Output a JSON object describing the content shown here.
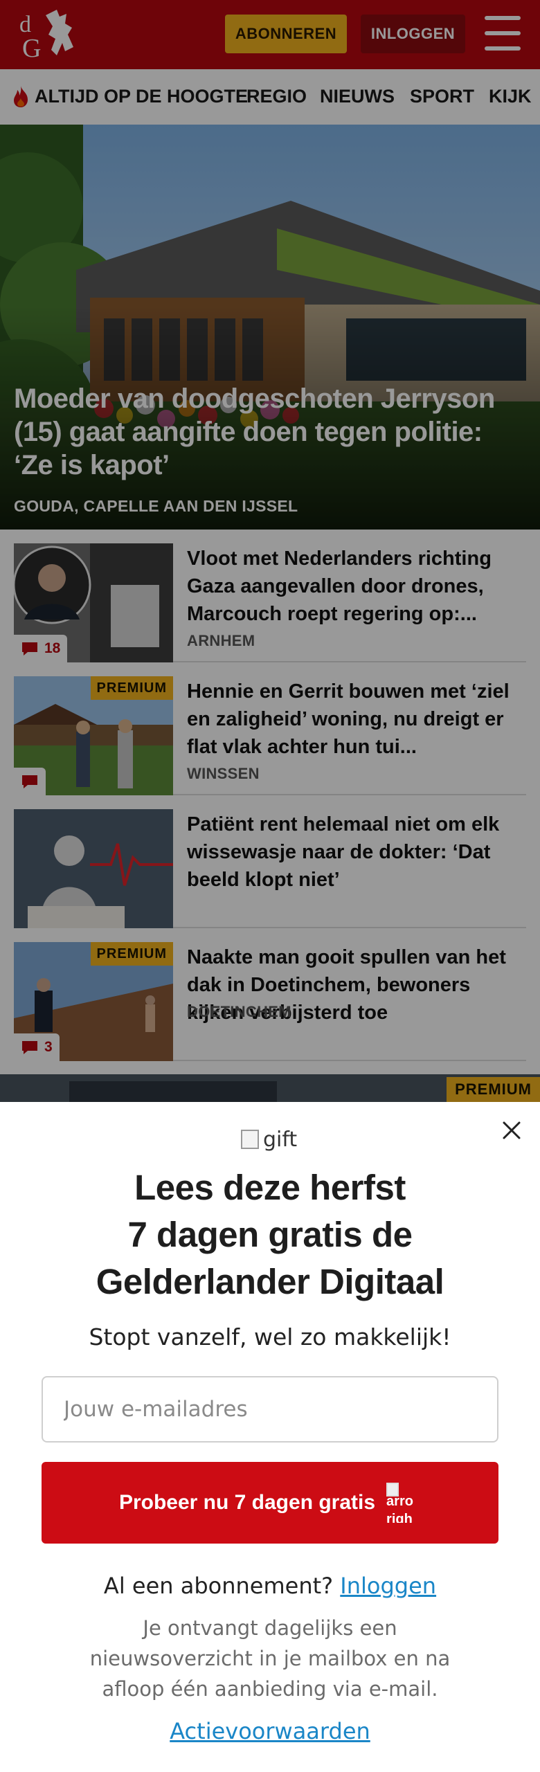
{
  "header": {
    "logo_text": "dG",
    "subscribe_label": "ABONNEREN",
    "login_label": "INLOGGEN",
    "brand_color": "#b7080f",
    "accent_color": "#f2b21f"
  },
  "nav": {
    "items": [
      {
        "label": "ALTIJD OP DE HOOGTE",
        "icon": "flame-icon"
      },
      {
        "label": "REGIO"
      },
      {
        "label": "NIEUWS"
      },
      {
        "label": "SPORT"
      },
      {
        "label": "KIJK"
      }
    ]
  },
  "hero": {
    "title": "Moeder van doodgeschoten Jerryson (15) gaat aangifte doen tegen politie: ‘Ze is kapot’",
    "location": "GOUDA, CAPELLE AAN DEN IJSSEL"
  },
  "articles": [
    {
      "title": "Vloot met Nederlanders richting Gaza aangevallen door drones, Marcouch roept regering op:...",
      "location": "ARNHEM",
      "comments": "18",
      "premium": ""
    },
    {
      "title": "Hennie en Gerrit bouwen met ‘ziel en zaligheid’ woning, nu dreigt er flat vlak achter hun tui...",
      "location": "WINSSEN",
      "comments": "",
      "premium": "PREMIUM"
    },
    {
      "title": "Patiënt rent helemaal niet om elk wissewasje naar de dokter: ‘Dat beeld klopt niet’",
      "location": "",
      "comments": "",
      "premium": ""
    },
    {
      "title": "Naakte man gooit spullen van het dak in Doetinchem, bewoners kijken verbijsterd toe",
      "location": "DOETINCHEM",
      "comments": "3",
      "premium": "PREMIUM"
    }
  ],
  "peek": {
    "premium": "PREMIUM"
  },
  "modal": {
    "gift_alt": "gift",
    "headline_1": "Lees deze herfst",
    "headline_2": "7 dagen gratis de",
    "headline_3": "Gelderlander Digitaal",
    "subtitle": "Stopt vanzelf, wel zo makkelijk!",
    "email_placeholder": "Jouw e-mailadres",
    "cta_label": "Probeer nu 7 dagen gratis",
    "cta_icon_alt_1": "arro",
    "cta_icon_alt_2": "righ",
    "already_text": "Al een abonnement?",
    "login_link": "Inloggen",
    "fine_print": "Je ontvangt dagelijks een nieuwsoverzicht in je mailbox en na afloop één aanbieding via e-mail.",
    "terms_link": "Actievoorwaarden"
  }
}
